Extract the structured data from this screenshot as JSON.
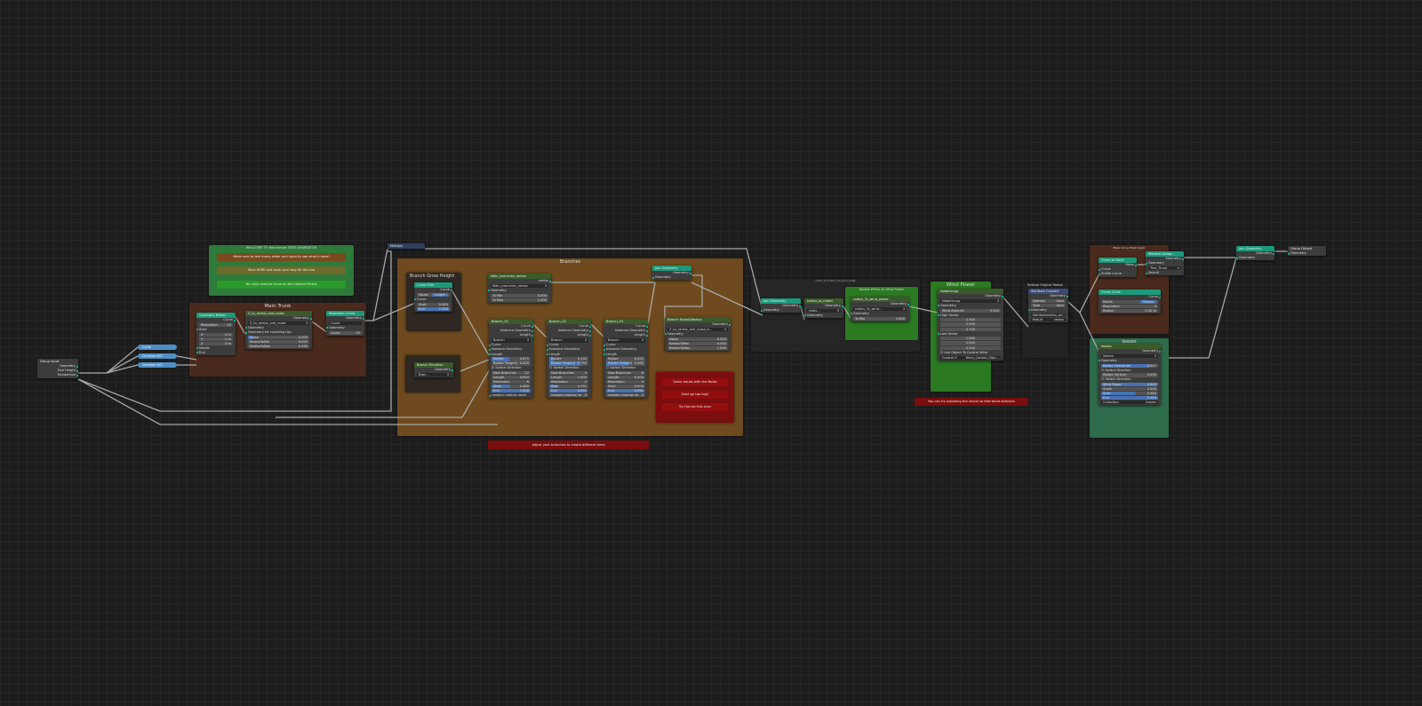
{
  "colors": {
    "geometry_header": "#1a9a7a",
    "group_header": "#3b5a2a",
    "math_header": "#2e3f5c",
    "attribute_header": "#3a4a7a",
    "socket": "#00d6a3",
    "bar": "#4772b3"
  },
  "frames": {
    "welcome": {
      "title": "WELCOME TO Randomize TREE GENERATOR",
      "color": "#2e7a3a"
    },
    "main_trunk": {
      "title": "Main Trunk",
      "color": "#4a2a1c"
    },
    "branches": {
      "title": "Branches",
      "color": "#6e4a1e"
    },
    "grow_height": {
      "title": "Branch Grow Height",
      "color": "#2f2822"
    },
    "primitive": {
      "title": "",
      "color": "#2f2822"
    },
    "issues": {
      "title": "",
      "color": "#7a0d0d"
    },
    "wind_group": {
      "title": "radius_to_meters_and_wind_nodes",
      "color": "#262626"
    },
    "radius_effect": {
      "title": "Radius Effect to Wind Power",
      "color": "#2b7a22"
    },
    "wind_power": {
      "title": "Wind Power",
      "color": "#2b7a22"
    },
    "restore": {
      "title": "Restore Original Radius",
      "color": "#222222"
    },
    "curve_mesh": {
      "title": "Make Curve Mesh Again",
      "color": "#4a2a1c"
    },
    "leaves": {
      "title": "leaves",
      "color": "#2e6b4a"
    }
  },
  "notes": {
    "welcome_1": "Make sure to test every slider and input to see what it does!",
    "welcome_2": "Start HERE and work your way till the end",
    "welcome_3": "You only need to focus on the colored Panels",
    "issue_1": "Some issues with the Noise",
    "issue_2": "Dont go too high",
    "issue_3": "Try this for this scen",
    "branches_tip": "Adjust your branches to create different trees",
    "wind_tip": "You can try adjusting the vector to fake bend direction"
  },
  "reroutes": [
    "Curve",
    "Combine XYZ",
    "Combine XYZ"
  ],
  "nodes": [
    {
      "id": "group_input",
      "title": "Group Input",
      "header": "#3c3c3c",
      "rows": [
        {
          "k": "out",
          "t": "Geometry"
        },
        {
          "k": "out",
          "t": "Tree Height"
        },
        {
          "k": "out",
          "t": "Randomize"
        }
      ]
    },
    {
      "id": "multiply",
      "title": "Multiply",
      "header": "#2e3f5c",
      "rows": []
    },
    {
      "id": "quad_bezier",
      "title": "Quadratic Bézier",
      "header": "#1a9a7a",
      "rows": [
        {
          "k": "out",
          "t": "Curve"
        },
        {
          "k": "field",
          "t": "Resolution",
          "v": "25"
        },
        {
          "k": "in",
          "t": "Start"
        },
        {
          "k": "field",
          "t": "X",
          "v": "0 m"
        },
        {
          "k": "field",
          "t": "Y",
          "v": "0 m"
        },
        {
          "k": "field",
          "t": "Z",
          "v": "0 m"
        },
        {
          "k": "in",
          "t": "Middle"
        },
        {
          "k": "in",
          "t": "End"
        }
      ]
    },
    {
      "id": "z_radius_noise",
      "title": "Z_to_radius_and_noise",
      "header": "#3b5a2a",
      "rows": [
        {
          "k": "out",
          "t": "Geometry"
        },
        {
          "k": "sel",
          "t": "Z_to_radius_and_noise",
          "v": "3"
        },
        {
          "k": "in",
          "t": "Geometry"
        },
        {
          "k": "in",
          "t": "Geometry for rounding tips"
        },
        {
          "k": "bar",
          "t": "Noise",
          "v": "0.200",
          "f": "8%"
        },
        {
          "k": "field",
          "t": "RadiusToMin",
          "v": "0.050"
        },
        {
          "k": "field",
          "t": "RadiusToMax",
          "v": "0.260"
        }
      ]
    },
    {
      "id": "resample",
      "title": "Resample Curve",
      "header": "#1a9a7a",
      "rows": [
        {
          "k": "out",
          "t": "Geometry"
        },
        {
          "k": "sel",
          "t": "Count",
          "v": ""
        },
        {
          "k": "in",
          "t": "Geometry"
        },
        {
          "k": "field",
          "t": "Count",
          "v": "25"
        }
      ]
    },
    {
      "id": "curve_trim",
      "title": "Curve Trim",
      "header": "#1a9a7a",
      "rows": [
        {
          "k": "out",
          "t": "Curve"
        },
        {
          "k": "seg",
          "t": "Factor",
          "v": "Length"
        },
        {
          "k": "in",
          "t": "Curve"
        },
        {
          "k": "field",
          "t": "Start",
          "v": "0.063"
        },
        {
          "k": "bar",
          "t": "End",
          "v": "1.000",
          "f": "100%"
        }
      ]
    },
    {
      "id": "branch_primitive",
      "title": "Branch Primitive",
      "header": "#3b5a2a",
      "rows": [
        {
          "k": "out",
          "t": "Geometry"
        },
        {
          "k": "sel",
          "t": "Bran...",
          "v": "3"
        }
      ]
    },
    {
      "id": "main_branches_radius",
      "title": "Main_branches_radius",
      "header": "#3b5a2a",
      "rows": [
        {
          "k": "out",
          "t": "radius"
        },
        {
          "k": "sel",
          "t": "Main_branches_radius",
          "v": "3"
        },
        {
          "k": "in",
          "t": "Geometry"
        },
        {
          "k": "field",
          "t": "To Min",
          "v": "0.000"
        },
        {
          "k": "field",
          "t": "To Max",
          "v": "1.000"
        }
      ]
    },
    {
      "id": "branch_01",
      "title": "Branch_01",
      "header": "#3b5a2a",
      "rows": [
        {
          "k": "out",
          "t": "Curve"
        },
        {
          "k": "out",
          "t": "Instance Geometry"
        },
        {
          "k": "out",
          "t": "Length"
        },
        {
          "k": "sel",
          "t": "Branch",
          "v": "3"
        },
        {
          "k": "in",
          "t": "Curve"
        },
        {
          "k": "in",
          "t": "Instance Geometry"
        },
        {
          "k": "in",
          "t": "Length"
        },
        {
          "k": "bar",
          "t": "Rotate",
          "v": "0.675",
          "f": "45%"
        },
        {
          "k": "field",
          "t": "Rotate Tangent",
          "v": "0.000"
        },
        {
          "k": "check",
          "t": "Switch Direction",
          "on": true
        },
        {
          "k": "field",
          "t": "New Branches",
          "v": "12"
        },
        {
          "k": "field",
          "t": "Length",
          "v": "0.650"
        },
        {
          "k": "field",
          "t": "Resolution",
          "v": "6"
        },
        {
          "k": "bar",
          "t": "Start",
          "v": "0.485",
          "f": "48%"
        },
        {
          "k": "bar",
          "t": "End",
          "v": "1.000",
          "f": "100%"
        },
        {
          "k": "in",
          "t": "random rotation seed"
        }
      ]
    },
    {
      "id": "branch_02",
      "title": "Branch_02",
      "header": "#3b5a2a",
      "rows": [
        {
          "k": "out",
          "t": "Curve"
        },
        {
          "k": "out",
          "t": "Instance Geometry"
        },
        {
          "k": "out",
          "t": "Length"
        },
        {
          "k": "sel",
          "t": "Branch",
          "v": "3"
        },
        {
          "k": "in",
          "t": "Curve"
        },
        {
          "k": "in",
          "t": "Instance Geometry"
        },
        {
          "k": "in",
          "t": "Length"
        },
        {
          "k": "bar",
          "t": "Rotate",
          "v": "0.132",
          "f": "13%"
        },
        {
          "k": "bar",
          "t": "Rotate Tangent",
          "v": "0.794",
          "f": "79%"
        },
        {
          "k": "check",
          "t": "Switch Direction",
          "on": false
        },
        {
          "k": "field",
          "t": "New Branches",
          "v": "4"
        },
        {
          "k": "field",
          "t": "Length",
          "v": "1.000"
        },
        {
          "k": "field",
          "t": "Resolution",
          "v": "4"
        },
        {
          "k": "bar",
          "t": "Start",
          "v": "0.191",
          "f": "19%"
        },
        {
          "k": "bar",
          "t": "End",
          "v": "0.950",
          "f": "95%"
        },
        {
          "k": "field",
          "t": "random rotation se",
          "v": "0"
        }
      ]
    },
    {
      "id": "branch_03",
      "title": "Branch_03",
      "header": "#3b5a2a",
      "rows": [
        {
          "k": "out",
          "t": "Curve"
        },
        {
          "k": "out",
          "t": "Instance Geometry"
        },
        {
          "k": "out",
          "t": "Length"
        },
        {
          "k": "sel",
          "t": "Branch",
          "v": "3"
        },
        {
          "k": "in",
          "t": "Curve"
        },
        {
          "k": "in",
          "t": "Instance Geometry"
        },
        {
          "k": "in",
          "t": "Length"
        },
        {
          "k": "field",
          "t": "Rotate",
          "v": "0.022"
        },
        {
          "k": "bar",
          "t": "Rotate Tangent",
          "v": "0.589",
          "f": "59%"
        },
        {
          "k": "check",
          "t": "Switch Direction",
          "on": false
        },
        {
          "k": "field",
          "t": "New Branches",
          "v": "8"
        },
        {
          "k": "field",
          "t": "Length",
          "v": "0.500"
        },
        {
          "k": "field",
          "t": "Resolution",
          "v": "4"
        },
        {
          "k": "field",
          "t": "Start",
          "v": "0.000"
        },
        {
          "k": "bar",
          "t": "End",
          "v": "0.950",
          "f": "95%"
        },
        {
          "k": "field",
          "t": "random rotation se",
          "v": "0"
        }
      ]
    },
    {
      "id": "join_branches",
      "title": "Join Geometry",
      "header": "#1a9a7a",
      "rows": [
        {
          "k": "out",
          "t": "Geometry"
        },
        {
          "k": "in",
          "t": "Geometry"
        }
      ]
    },
    {
      "id": "branch_noise",
      "title": "Branch Noise&Radius",
      "header": "#3b5a2a",
      "rows": [
        {
          "k": "out",
          "t": "Geometry"
        },
        {
          "k": "sel",
          "t": "Z_to_radius_and_noise_b...",
          "v": "3"
        },
        {
          "k": "in",
          "t": "Geometry"
        },
        {
          "k": "field",
          "t": "Noise",
          "v": "0.050"
        },
        {
          "k": "field",
          "t": "RadiusToMin",
          "v": "0.050"
        },
        {
          "k": "field",
          "t": "RadiusToMax",
          "v": "1.000"
        }
      ]
    },
    {
      "id": "join_main",
      "title": "Join Geometry",
      "header": "#1a9a7a",
      "rows": [
        {
          "k": "out",
          "t": "Geometry"
        },
        {
          "k": "in",
          "t": "Geometry"
        }
      ]
    },
    {
      "id": "radius_to_meter",
      "title": "radius_to_meter",
      "header": "#3b5a2a",
      "rows": [
        {
          "k": "out",
          "t": "Geometry"
        },
        {
          "k": "sel",
          "t": "radiu...",
          "v": "3"
        },
        {
          "k": "in",
          "t": "Geometry"
        }
      ]
    },
    {
      "id": "radius_wind",
      "title": "radius_To_wind_power",
      "header": "#3b5a2a",
      "rows": [
        {
          "k": "out",
          "t": "Geometry"
        },
        {
          "k": "sel",
          "t": "radius_To_wind...",
          "v": "3"
        },
        {
          "k": "in",
          "t": "Geometry"
        },
        {
          "k": "field",
          "t": "To Min",
          "v": "1.000"
        }
      ]
    },
    {
      "id": "wind_node",
      "title": "NodeGroup",
      "header": "#3b5a2a",
      "rows": [
        {
          "k": "out",
          "t": "Geometry"
        },
        {
          "k": "sel",
          "t": "NodeGroup",
          "v": "3"
        },
        {
          "k": "in",
          "t": "Geometry"
        },
        {
          "k": "field",
          "t": "Wind Amount",
          "v": "0.200"
        },
        {
          "k": "in",
          "t": "High Vector"
        },
        {
          "k": "vec",
          "v": "2.000"
        },
        {
          "k": "vec",
          "v": "2.000"
        },
        {
          "k": "vec",
          "v": "0.700"
        },
        {
          "k": "in",
          "t": "Low Vector"
        },
        {
          "k": "vec",
          "v": "1.000"
        },
        {
          "k": "vec",
          "v": "1.000"
        },
        {
          "k": "vec",
          "v": "0.200"
        },
        {
          "k": "check",
          "t": "Use Object To Control Wind",
          "on": false
        },
        {
          "k": "sel",
          "t": "Control O",
          "v": "Wind_Control_Obje..."
        }
      ]
    },
    {
      "id": "attr_convert",
      "title": "Attribute Convert",
      "header": "#3a4a7a",
      "rows": [
        {
          "k": "out",
          "t": "Geometry"
        },
        {
          "k": "field",
          "t": "Domain",
          "v": "Auto"
        },
        {
          "k": "field",
          "t": "Type",
          "v": "Auto"
        },
        {
          "k": "in",
          "t": "Geometry"
        },
        {
          "k": "sel",
          "t": "Attribute",
          "v": "radius_ori..."
        },
        {
          "k": "sel",
          "t": "Result",
          "v": "radius"
        }
      ]
    },
    {
      "id": "curve_to_mesh",
      "title": "Curve to Mesh",
      "header": "#1a9a7a",
      "rows": [
        {
          "k": "out",
          "t": "Mesh"
        },
        {
          "k": "in",
          "t": "Curve"
        },
        {
          "k": "in",
          "t": "Profile Curve"
        }
      ]
    },
    {
      "id": "material_assign",
      "title": "Material Assign",
      "header": "#1a9a7a",
      "rows": [
        {
          "k": "out",
          "t": "Geometry"
        },
        {
          "k": "in",
          "t": "Geometry"
        },
        {
          "k": "sel",
          "t": "Tree_Trunk",
          "v": "x"
        },
        {
          "k": "in",
          "t": "Selecti"
        }
      ]
    },
    {
      "id": "curve_circle",
      "title": "Curve Circle",
      "header": "#1a9a7a",
      "rows": [
        {
          "k": "out",
          "t": "Curve"
        },
        {
          "k": "seg",
          "t": "Points",
          "v": "Radius"
        },
        {
          "k": "field",
          "t": "Resolution",
          "v": "5"
        },
        {
          "k": "field",
          "t": "Radius",
          "v": "0.02 m"
        }
      ]
    },
    {
      "id": "leaves_node",
      "title": "leaves",
      "header": "#3b5a2a",
      "rows": [
        {
          "k": "out",
          "t": "Geometry"
        },
        {
          "k": "sel",
          "t": "leaves",
          "v": "3"
        },
        {
          "k": "in",
          "t": "Geometry"
        },
        {
          "k": "bar",
          "t": "Rotate Horizontal",
          "v": "0.847",
          "f": "85%"
        },
        {
          "k": "check",
          "t": "Switch Direction",
          "on": false
        },
        {
          "k": "field",
          "t": "Rotate Vertical",
          "v": "0.000"
        },
        {
          "k": "check",
          "t": "Switch Direction",
          "on": false
        },
        {
          "k": "bar",
          "t": "Wind Power",
          "v": "0.800",
          "f": "100%"
        },
        {
          "k": "field",
          "t": "Scale",
          "v": "0.500"
        },
        {
          "k": "bar",
          "t": "Start",
          "v": "0.380",
          "f": "60%"
        },
        {
          "k": "bar",
          "t": "End",
          "v": "0.950",
          "f": "100%"
        },
        {
          "k": "sel",
          "t": "Collection",
          "v": "leaves"
        }
      ]
    },
    {
      "id": "join_final",
      "title": "Join Geometry",
      "header": "#1a9a7a",
      "rows": [
        {
          "k": "out",
          "t": "Geometry"
        },
        {
          "k": "in",
          "t": "Geometry"
        }
      ]
    },
    {
      "id": "group_output",
      "title": "Group Output",
      "header": "#3c3c3c",
      "rows": [
        {
          "k": "in",
          "t": "Geometry"
        }
      ]
    }
  ]
}
